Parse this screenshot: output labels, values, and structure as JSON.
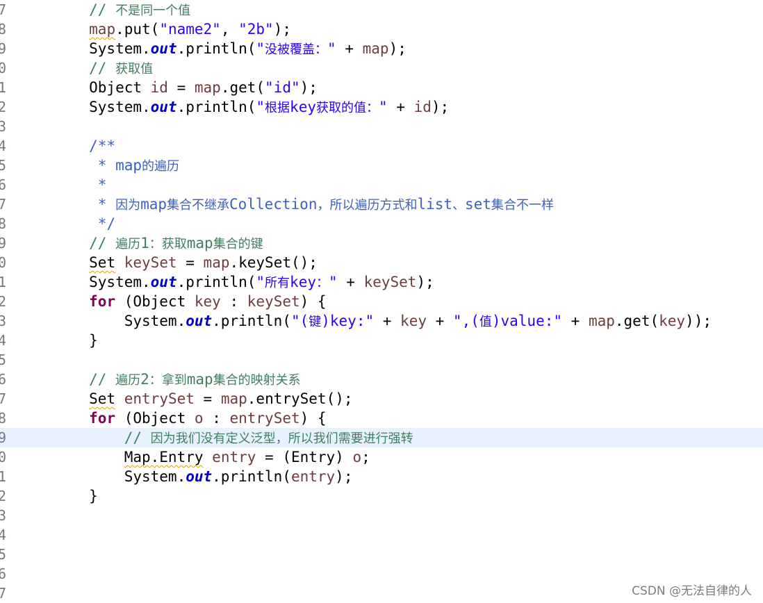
{
  "editor": {
    "lines": [
      {
        "no": "7",
        "code": [
          {
            "t": "        "
          },
          {
            "t": "// ",
            "c": "com"
          },
          {
            "t": "不是同一个值",
            "c": "com zh"
          }
        ]
      },
      {
        "no": "8",
        "code": [
          {
            "t": "        "
          },
          {
            "t": "map",
            "c": "var warn"
          },
          {
            "t": ".put("
          },
          {
            "t": "\"name2\"",
            "c": "str"
          },
          {
            "t": ", "
          },
          {
            "t": "\"2b\"",
            "c": "str"
          },
          {
            "t": ");"
          }
        ]
      },
      {
        "no": "9",
        "code": [
          {
            "t": "        System."
          },
          {
            "t": "out",
            "c": "field"
          },
          {
            "t": ".println("
          },
          {
            "t": "\"",
            "c": "str"
          },
          {
            "t": "没被覆盖：",
            "c": "str zh"
          },
          {
            "t": "\"",
            "c": "str"
          },
          {
            "t": " + "
          },
          {
            "t": "map",
            "c": "var"
          },
          {
            "t": ");"
          }
        ]
      },
      {
        "no": "0",
        "code": [
          {
            "t": "        "
          },
          {
            "t": "// ",
            "c": "com"
          },
          {
            "t": "获取值",
            "c": "com zh"
          }
        ]
      },
      {
        "no": "1",
        "code": [
          {
            "t": "        Object "
          },
          {
            "t": "id",
            "c": "var"
          },
          {
            "t": " = "
          },
          {
            "t": "map",
            "c": "var"
          },
          {
            "t": ".get("
          },
          {
            "t": "\"id\"",
            "c": "str"
          },
          {
            "t": ");"
          }
        ]
      },
      {
        "no": "2",
        "code": [
          {
            "t": "        System."
          },
          {
            "t": "out",
            "c": "field"
          },
          {
            "t": ".println("
          },
          {
            "t": "\"",
            "c": "str"
          },
          {
            "t": "根据",
            "c": "str zh"
          },
          {
            "t": "key",
            "c": "str"
          },
          {
            "t": "获取的值：",
            "c": "str zh"
          },
          {
            "t": "\"",
            "c": "str"
          },
          {
            "t": " + "
          },
          {
            "t": "id",
            "c": "var"
          },
          {
            "t": ");"
          }
        ]
      },
      {
        "no": "3",
        "code": []
      },
      {
        "no": "4",
        "code": [
          {
            "t": "        "
          },
          {
            "t": "/**",
            "c": "doc"
          }
        ]
      },
      {
        "no": "5",
        "code": [
          {
            "t": "         "
          },
          {
            "t": "* map",
            "c": "doc"
          },
          {
            "t": "的遍历",
            "c": "doc zh"
          }
        ]
      },
      {
        "no": "6",
        "code": [
          {
            "t": "         "
          },
          {
            "t": "*",
            "c": "doc"
          }
        ]
      },
      {
        "no": "7",
        "code": [
          {
            "t": "         "
          },
          {
            "t": "* ",
            "c": "doc"
          },
          {
            "t": "因为",
            "c": "doc zh"
          },
          {
            "t": "map",
            "c": "doc"
          },
          {
            "t": "集合不继承",
            "c": "doc zh"
          },
          {
            "t": "Collection",
            "c": "doc"
          },
          {
            "t": "，所以遍历方式和",
            "c": "doc zh"
          },
          {
            "t": "list",
            "c": "doc"
          },
          {
            "t": "、",
            "c": "doc zh"
          },
          {
            "t": "set",
            "c": "doc"
          },
          {
            "t": "集合不一样",
            "c": "doc zh"
          }
        ]
      },
      {
        "no": "8",
        "code": [
          {
            "t": "         "
          },
          {
            "t": "*/",
            "c": "doc"
          }
        ]
      },
      {
        "no": "9",
        "code": [
          {
            "t": "        "
          },
          {
            "t": "// ",
            "c": "com"
          },
          {
            "t": "遍历",
            "c": "com zh"
          },
          {
            "t": "1",
            "c": "com"
          },
          {
            "t": "：获取",
            "c": "com zh"
          },
          {
            "t": "map",
            "c": "com"
          },
          {
            "t": "集合的键",
            "c": "com zh"
          }
        ]
      },
      {
        "no": "0",
        "code": [
          {
            "t": "        "
          },
          {
            "t": "Set",
            "c": "warn"
          },
          {
            "t": " "
          },
          {
            "t": "keySet",
            "c": "var"
          },
          {
            "t": " = "
          },
          {
            "t": "map",
            "c": "var"
          },
          {
            "t": ".keySet();"
          }
        ]
      },
      {
        "no": "1",
        "code": [
          {
            "t": "        System."
          },
          {
            "t": "out",
            "c": "field"
          },
          {
            "t": ".println("
          },
          {
            "t": "\"",
            "c": "str"
          },
          {
            "t": "所有",
            "c": "str zh"
          },
          {
            "t": "key",
            "c": "str"
          },
          {
            "t": "：",
            "c": "str zh"
          },
          {
            "t": "\"",
            "c": "str"
          },
          {
            "t": " + "
          },
          {
            "t": "keySet",
            "c": "var"
          },
          {
            "t": ");"
          }
        ]
      },
      {
        "no": "2",
        "code": [
          {
            "t": "        "
          },
          {
            "t": "for",
            "c": "kw"
          },
          {
            "t": " (Object "
          },
          {
            "t": "key",
            "c": "var"
          },
          {
            "t": " : "
          },
          {
            "t": "keySet",
            "c": "var"
          },
          {
            "t": ") {"
          }
        ]
      },
      {
        "no": "3",
        "code": [
          {
            "t": "            System."
          },
          {
            "t": "out",
            "c": "field"
          },
          {
            "t": ".println("
          },
          {
            "t": "\"(",
            "c": "str"
          },
          {
            "t": "键",
            "c": "str zh"
          },
          {
            "t": ")key:\"",
            "c": "str"
          },
          {
            "t": " + "
          },
          {
            "t": "key",
            "c": "var"
          },
          {
            "t": " + "
          },
          {
            "t": "\",(",
            "c": "str"
          },
          {
            "t": "值",
            "c": "str zh"
          },
          {
            "t": ")value:\"",
            "c": "str"
          },
          {
            "t": " + "
          },
          {
            "t": "map",
            "c": "var"
          },
          {
            "t": ".get("
          },
          {
            "t": "key",
            "c": "var"
          },
          {
            "t": "));"
          }
        ]
      },
      {
        "no": "4",
        "code": [
          {
            "t": "        }"
          }
        ]
      },
      {
        "no": "5",
        "code": []
      },
      {
        "no": "6",
        "code": [
          {
            "t": "        "
          },
          {
            "t": "// ",
            "c": "com"
          },
          {
            "t": "遍历",
            "c": "com zh"
          },
          {
            "t": "2",
            "c": "com"
          },
          {
            "t": "：拿到",
            "c": "com zh"
          },
          {
            "t": "map",
            "c": "com"
          },
          {
            "t": "集合的映射关系",
            "c": "com zh"
          }
        ]
      },
      {
        "no": "7",
        "code": [
          {
            "t": "        "
          },
          {
            "t": "Set",
            "c": "warn"
          },
          {
            "t": " "
          },
          {
            "t": "entrySet",
            "c": "var"
          },
          {
            "t": " = "
          },
          {
            "t": "map",
            "c": "var"
          },
          {
            "t": ".entrySet();"
          }
        ]
      },
      {
        "no": "8",
        "code": [
          {
            "t": "        "
          },
          {
            "t": "for",
            "c": "kw"
          },
          {
            "t": " (Object "
          },
          {
            "t": "o",
            "c": "var"
          },
          {
            "t": " : "
          },
          {
            "t": "entrySet",
            "c": "var"
          },
          {
            "t": ") {"
          }
        ]
      },
      {
        "no": "9",
        "highlight": true,
        "code": [
          {
            "t": "            "
          },
          {
            "t": "// ",
            "c": "com"
          },
          {
            "t": "因为我们没有定义泛型，所以我们需要进行强转",
            "c": "com zh"
          }
        ]
      },
      {
        "no": "0",
        "code": [
          {
            "t": "            "
          },
          {
            "t": "Map.Entry",
            "c": "warn"
          },
          {
            "t": " "
          },
          {
            "t": "entry",
            "c": "var"
          },
          {
            "t": " = (Entry) "
          },
          {
            "t": "o",
            "c": "var"
          },
          {
            "t": ";"
          }
        ]
      },
      {
        "no": "1",
        "code": [
          {
            "t": "            System."
          },
          {
            "t": "out",
            "c": "field"
          },
          {
            "t": ".println("
          },
          {
            "t": "entry",
            "c": "var"
          },
          {
            "t": ");"
          }
        ]
      },
      {
        "no": "2",
        "code": [
          {
            "t": "        }"
          }
        ]
      },
      {
        "no": "3",
        "code": []
      },
      {
        "no": "4",
        "code": []
      },
      {
        "no": "5",
        "code": []
      },
      {
        "no": "6",
        "code": []
      },
      {
        "no": "7",
        "code": []
      }
    ]
  },
  "watermark": "CSDN @无法自律的人"
}
